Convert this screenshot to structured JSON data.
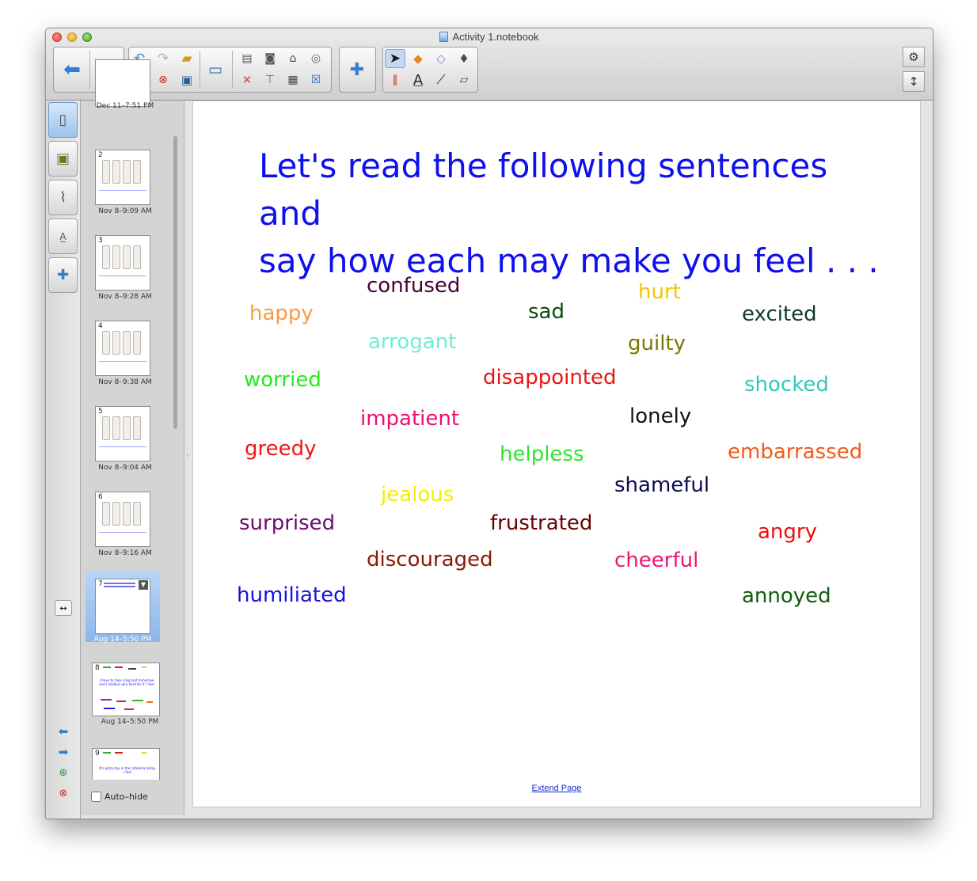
{
  "window": {
    "title": "Activity 1.notebook"
  },
  "sorter": {
    "pages": [
      {
        "num": "",
        "caption": "Dec 11–7:51 PM"
      },
      {
        "num": "2",
        "caption": "Nov 8–9:09 AM"
      },
      {
        "num": "3",
        "caption": "Nov 8–9:28 AM"
      },
      {
        "num": "4",
        "caption": "Nov 8–9:38 AM"
      },
      {
        "num": "5",
        "caption": "Nov 8–9:04 AM"
      },
      {
        "num": "6",
        "caption": "Nov 8–9:16 AM"
      },
      {
        "num": "7",
        "caption": "Aug 14–5:50 PM"
      },
      {
        "num": "8",
        "caption": "Aug 14–5:50 PM",
        "text": "I have to take a big test tomorrow and I studied very hard for it. I feel"
      },
      {
        "num": "9",
        "caption": "",
        "text": "It's pizza day in the cafeteria today. I feel"
      }
    ],
    "autohide_label": "Auto–hide"
  },
  "page": {
    "heading_line1": "Let's read the following sentences and",
    "heading_line2": "say how each may make you feel . . .",
    "words": [
      "confused",
      "hurt",
      "happy",
      "sad",
      "excited",
      "arrogant",
      "guilty",
      "worried",
      "disappointed",
      "shocked",
      "impatient",
      "lonely",
      "greedy",
      "helpless",
      "embarrassed",
      "shameful",
      "jealous",
      "surprised",
      "frustrated",
      "angry",
      "discouraged",
      "cheerful",
      "humiliated",
      "annoyed"
    ],
    "word_colors": {
      "confused": "#4b0034",
      "hurt": "#f5c400",
      "happy": "#f79a45",
      "sad": "#0b4a12",
      "excited": "#0d3a30",
      "arrogant": "#6df0cf",
      "guilty": "#7a7a00",
      "worried": "#27e81e",
      "disappointed": "#ea1414",
      "shocked": "#33c7bc",
      "impatient": "#ee0d72",
      "lonely": "#111111",
      "greedy": "#ee1616",
      "helpless": "#2fe62d",
      "embarrassed": "#f25a1d",
      "shameful": "#0a0a55",
      "jealous": "#f5ee00",
      "surprised": "#6d0b6f",
      "frustrated": "#6a0000",
      "angry": "#ee0d0d",
      "discouraged": "#8a1a02",
      "cheerful": "#ee1572",
      "humiliated": "#1212e0",
      "annoyed": "#0f5d0f"
    },
    "extend_link": "Extend Page"
  }
}
